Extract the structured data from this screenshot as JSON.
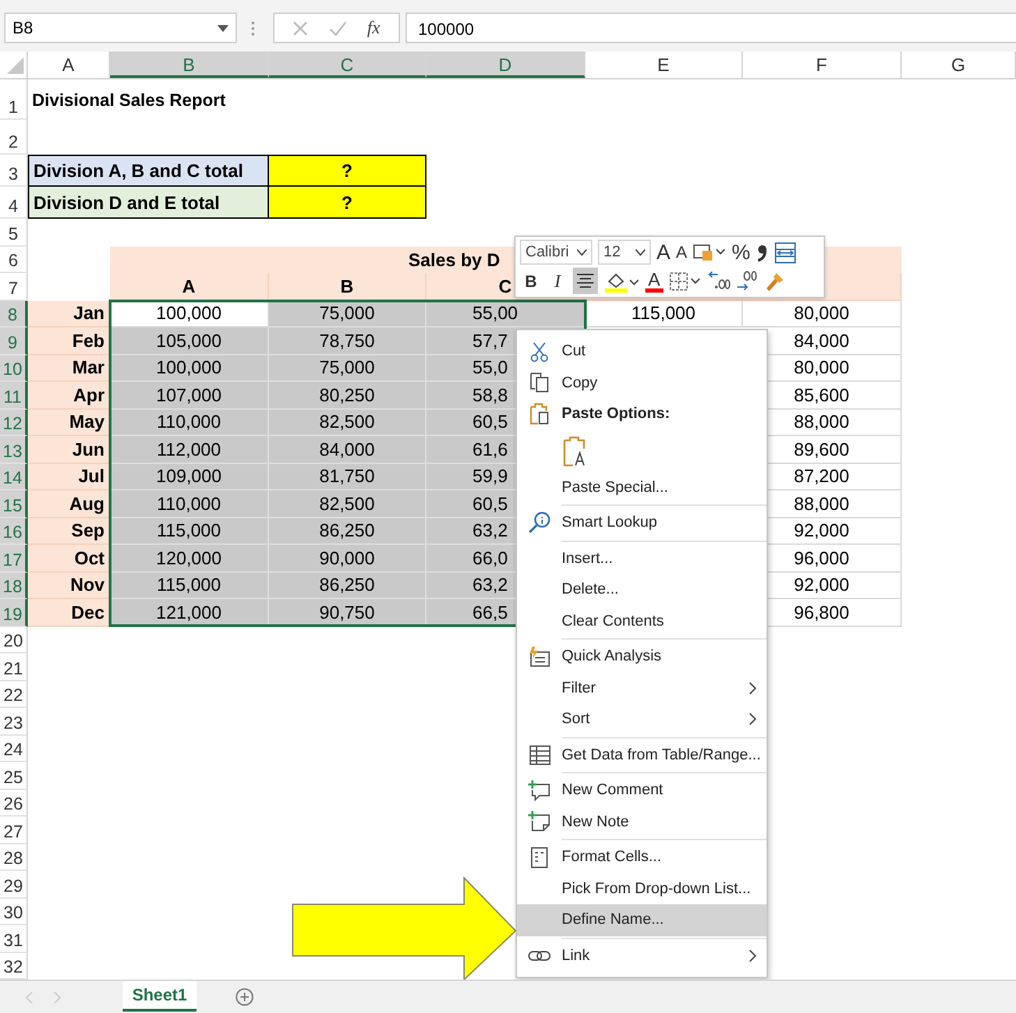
{
  "name_box": {
    "value": "B8"
  },
  "formula_bar": {
    "function_label": "fx",
    "value": "100000"
  },
  "columns": [
    {
      "label": "A",
      "selected": false
    },
    {
      "label": "B",
      "selected": true
    },
    {
      "label": "C",
      "selected": true
    },
    {
      "label": "D",
      "selected": true
    },
    {
      "label": "E",
      "selected": false
    },
    {
      "label": "F",
      "selected": false
    },
    {
      "label": "G",
      "selected": false
    }
  ],
  "row_headers": [
    {
      "label": "1",
      "selected": false
    },
    {
      "label": "2",
      "selected": false
    },
    {
      "label": "3",
      "selected": false
    },
    {
      "label": "4",
      "selected": false
    },
    {
      "label": "5",
      "selected": false
    },
    {
      "label": "6",
      "selected": false
    },
    {
      "label": "7",
      "selected": false
    },
    {
      "label": "8",
      "selected": true
    },
    {
      "label": "9",
      "selected": true
    },
    {
      "label": "10",
      "selected": true
    },
    {
      "label": "11",
      "selected": true
    },
    {
      "label": "12",
      "selected": true
    },
    {
      "label": "13",
      "selected": true
    },
    {
      "label": "14",
      "selected": true
    },
    {
      "label": "15",
      "selected": true
    },
    {
      "label": "16",
      "selected": true
    },
    {
      "label": "17",
      "selected": true
    },
    {
      "label": "18",
      "selected": true
    },
    {
      "label": "19",
      "selected": true
    },
    {
      "label": "20",
      "selected": false
    },
    {
      "label": "21",
      "selected": false
    },
    {
      "label": "22",
      "selected": false
    },
    {
      "label": "23",
      "selected": false
    },
    {
      "label": "24",
      "selected": false
    },
    {
      "label": "25",
      "selected": false
    },
    {
      "label": "26",
      "selected": false
    },
    {
      "label": "27",
      "selected": false
    },
    {
      "label": "28",
      "selected": false
    },
    {
      "label": "29",
      "selected": false
    },
    {
      "label": "30",
      "selected": false
    },
    {
      "label": "31",
      "selected": false
    },
    {
      "label": "32",
      "selected": false
    }
  ],
  "title": "Divisional Sales Report",
  "totals": [
    {
      "label": "Division A, B and C total",
      "value": "?",
      "color": "#dae3f3"
    },
    {
      "label": "Division D and E total",
      "value": "?",
      "color": "#e2efda"
    }
  ],
  "sales_table": {
    "heading": "Sales by D",
    "columns": [
      "A",
      "B",
      "C"
    ],
    "rows": [
      {
        "month": "Jan",
        "selected": true,
        "active": true,
        "a": "100,000",
        "b": "75,000",
        "c": "55,00",
        "d": "115,000",
        "e": "80,000"
      },
      {
        "month": "Feb",
        "selected": true,
        "active": false,
        "a": "105,000",
        "b": "78,750",
        "c": "57,7",
        "e": "84,000"
      },
      {
        "month": "Mar",
        "selected": true,
        "active": false,
        "a": "100,000",
        "b": "75,000",
        "c": "55,0",
        "e": "80,000"
      },
      {
        "month": "Apr",
        "selected": true,
        "active": false,
        "a": "107,000",
        "b": "80,250",
        "c": "58,8",
        "e": "85,600"
      },
      {
        "month": "May",
        "selected": true,
        "active": false,
        "a": "110,000",
        "b": "82,500",
        "c": "60,5",
        "e": "88,000"
      },
      {
        "month": "Jun",
        "selected": true,
        "active": false,
        "a": "112,000",
        "b": "84,000",
        "c": "61,6",
        "e": "89,600"
      },
      {
        "month": "Jul",
        "selected": true,
        "active": false,
        "a": "109,000",
        "b": "81,750",
        "c": "59,9",
        "e": "87,200"
      },
      {
        "month": "Aug",
        "selected": true,
        "active": false,
        "a": "110,000",
        "b": "82,500",
        "c": "60,5",
        "e": "88,000"
      },
      {
        "month": "Sep",
        "selected": true,
        "active": false,
        "a": "115,000",
        "b": "86,250",
        "c": "63,2",
        "e": "92,000"
      },
      {
        "month": "Oct",
        "selected": true,
        "active": false,
        "a": "120,000",
        "b": "90,000",
        "c": "66,0",
        "e": "96,000"
      },
      {
        "month": "Nov",
        "selected": true,
        "active": false,
        "a": "115,000",
        "b": "86,250",
        "c": "63,2",
        "e": "92,000"
      },
      {
        "month": "Dec",
        "selected": true,
        "active": false,
        "a": "121,000",
        "b": "90,750",
        "c": "66,5",
        "e": "96,800"
      }
    ]
  },
  "mini_toolbar": {
    "font": "Calibri",
    "size": "12",
    "row_1": [
      {
        "kind": "grow",
        "label": "A"
      },
      {
        "kind": "shrink",
        "label": "A"
      },
      {
        "kind": "styles"
      },
      {
        "kind": "percent",
        "label": "%"
      },
      {
        "kind": "comma"
      },
      {
        "kind": "wrap"
      }
    ],
    "row_2": [
      {
        "kind": "bold",
        "label": "B",
        "selected": false
      },
      {
        "kind": "italic",
        "label": "I",
        "selected": false
      },
      {
        "kind": "center",
        "selected": true
      },
      {
        "kind": "fill",
        "color": "#ffff00"
      },
      {
        "kind": "fontcolor",
        "label": "A",
        "color": "#ff0000"
      },
      {
        "kind": "borders"
      },
      {
        "kind": "incdec"
      },
      {
        "kind": "decdec"
      },
      {
        "kind": "painter"
      }
    ]
  },
  "context_menu": {
    "items": [
      {
        "kind": "cut",
        "label": "Cut",
        "submenu": false,
        "selected": false
      },
      {
        "kind": "copy",
        "label": "Copy",
        "submenu": false,
        "selected": false
      },
      {
        "kind": "paste",
        "label": "Paste Options:",
        "submenu": false,
        "selected": false
      },
      {
        "kind": "pastebutton"
      },
      {
        "kind": "command",
        "label": "Paste Special...",
        "submenu": false,
        "selected": false
      },
      {
        "kind": "separator"
      },
      {
        "kind": "lookup",
        "label": "Smart Lookup",
        "submenu": false,
        "selected": false
      },
      {
        "kind": "separator"
      },
      {
        "kind": "command",
        "label": "Insert...",
        "submenu": false,
        "selected": false
      },
      {
        "kind": "command",
        "label": "Delete...",
        "submenu": false,
        "selected": false
      },
      {
        "kind": "command",
        "label": "Clear Contents",
        "submenu": false,
        "selected": false
      },
      {
        "kind": "separator"
      },
      {
        "kind": "analysis",
        "label": "Quick Analysis",
        "submenu": false,
        "selected": false
      },
      {
        "kind": "command",
        "label": "Filter",
        "submenu": true,
        "selected": false
      },
      {
        "kind": "command",
        "label": "Sort",
        "submenu": true,
        "selected": false
      },
      {
        "kind": "separator"
      },
      {
        "kind": "getdata",
        "label": "Get Data from Table/Range...",
        "submenu": false,
        "selected": false
      },
      {
        "kind": "separator"
      },
      {
        "kind": "comment",
        "label": "New Comment",
        "submenu": false,
        "selected": false
      },
      {
        "kind": "note",
        "label": "New Note",
        "submenu": false,
        "selected": false
      },
      {
        "kind": "separator"
      },
      {
        "kind": "format",
        "label": "Format Cells...",
        "submenu": false,
        "selected": false
      },
      {
        "kind": "command",
        "label": "Pick From Drop-down List...",
        "submenu": false,
        "selected": false
      },
      {
        "kind": "command",
        "label": "Define Name...",
        "submenu": false,
        "selected": true
      },
      {
        "kind": "separator"
      },
      {
        "kind": "link",
        "label": "Link",
        "submenu": true,
        "selected": false
      }
    ]
  },
  "sheet_tabs": [
    {
      "label": "Sheet1",
      "selected": true
    }
  ]
}
